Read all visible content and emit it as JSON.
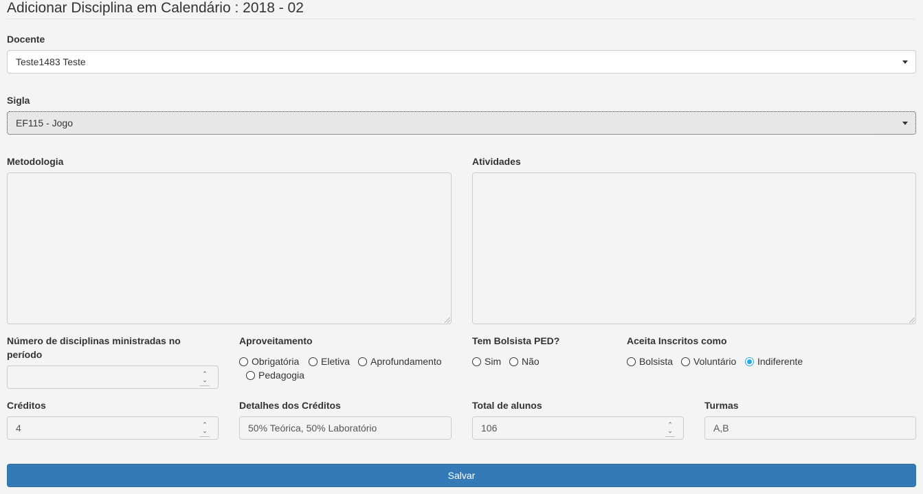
{
  "page": {
    "title": "Adicionar Disciplina em Calendário : 2018 - 02"
  },
  "docente": {
    "label": "Docente",
    "value": "Teste1483 Teste"
  },
  "sigla": {
    "label": "Sigla",
    "value": "EF115 - Jogo"
  },
  "metodologia": {
    "label": "Metodologia",
    "value": ""
  },
  "atividades": {
    "label": "Atividades",
    "value": ""
  },
  "num_disciplinas": {
    "label_line1": "Número de disciplinas ministradas no",
    "label_line2": "período",
    "value": ""
  },
  "aproveitamento": {
    "label": "Aproveitamento",
    "options": [
      "Obrigatória",
      "Eletiva",
      "Aprofundamento",
      "Pedagogia"
    ],
    "selected": null
  },
  "bolsista_ped": {
    "label": "Tem Bolsista PED?",
    "options": [
      "Sim",
      "Não"
    ],
    "selected": null
  },
  "aceita_inscritos": {
    "label": "Aceita Inscritos como",
    "options": [
      "Bolsista",
      "Voluntário",
      "Indiferente"
    ],
    "selected": "Indiferente"
  },
  "creditos": {
    "label": "Créditos",
    "value": "4"
  },
  "detalhes_creditos": {
    "label": "Detalhes dos Créditos",
    "value": "50% Teórica, 50% Laboratório"
  },
  "total_alunos": {
    "label": "Total de alunos",
    "value": "106"
  },
  "turmas": {
    "label": "Turmas",
    "value": "A,B"
  },
  "actions": {
    "save_label": "Salvar"
  },
  "colors": {
    "primary": "#337ab7",
    "radio_checked": "#29a9e1",
    "background": "#f4f4f4"
  }
}
